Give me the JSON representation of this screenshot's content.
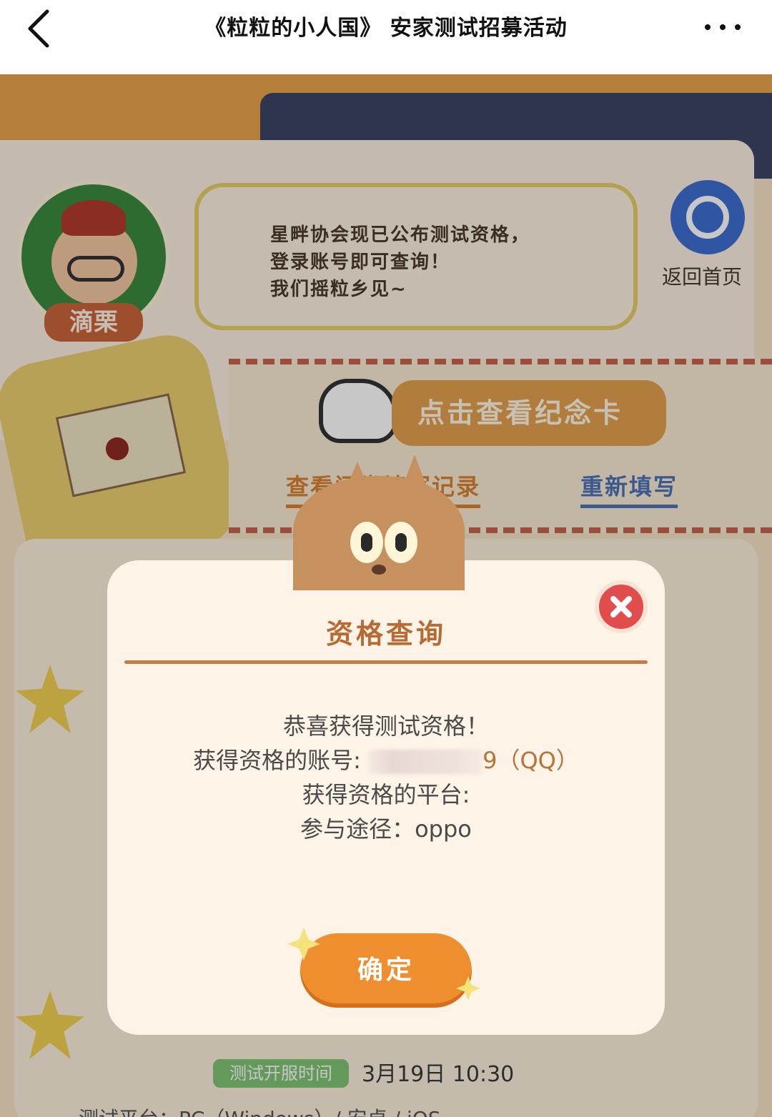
{
  "navbar": {
    "title": "《粒粒的小人国》 安家测试招募活动"
  },
  "speech": {
    "line1": "星畔协会现已公布测试资格，",
    "line2": "登录账号即可查询！",
    "line3": "我们摇粒乡见~"
  },
  "character": {
    "name": "滴栗"
  },
  "home": {
    "label": "返回首页"
  },
  "card": {
    "button_label": "点击查看纪念卡",
    "record_link": "查看问卷填写记录",
    "refill_link": "重新填写"
  },
  "schedule": {
    "chip_label": "测试开服时间",
    "chip_value": "3月19日  10:30",
    "platform_text": "测试平台：PC（Windows）/ 安卓 / iOS"
  },
  "modal": {
    "title": "资格查询",
    "congrats": "恭喜获得测试资格！",
    "account_label": "获得资格的账号:",
    "account_suffix": "9（QQ）",
    "platform_label": "获得资格的平台:",
    "route_label": "参与途径：oppo",
    "confirm_label": "确定"
  },
  "colors": {
    "modal_bg": "#fdf3e6",
    "title": "#b96a32",
    "confirm": "#ee8e2e",
    "close": "#e14c4c"
  }
}
